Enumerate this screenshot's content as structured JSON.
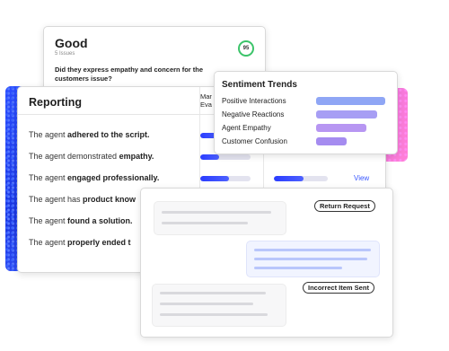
{
  "good_card": {
    "title": "Good",
    "subtitle": "5 Issues",
    "score": "95",
    "question": "Did they express empathy and concern for the customers issue?"
  },
  "reporting": {
    "title": "Reporting",
    "col_head_line1": "Mar",
    "col_head_line2": "Eva",
    "rows": [
      {
        "prefix": "The agent ",
        "bold": "adhered to the script.",
        "bar1": 0.38,
        "bar2": 0.0
      },
      {
        "prefix": "The agent demonstrated ",
        "bold": "empathy.",
        "bar1": 0.38,
        "bar2": 0.0
      },
      {
        "prefix": "The agent ",
        "bold": "engaged professionally.",
        "bar1": 0.58,
        "bar2": 0.55
      },
      {
        "prefix": "The agent has ",
        "bold": "product know",
        "bar1": 0,
        "bar2": 0
      },
      {
        "prefix": "The agent ",
        "bold": "found a solution.",
        "bar1": 0,
        "bar2": 0
      },
      {
        "prefix": "The agent ",
        "bold": "properly ended t",
        "bar1": 0,
        "bar2": 0
      }
    ],
    "view_link": "View"
  },
  "sentiment": {
    "title": "Sentiment Trends",
    "items": [
      {
        "label": "Positive Interactions",
        "value": 0.96,
        "color": "#8fa6f5"
      },
      {
        "label": "Negative Reactions",
        "value": 0.85,
        "color": "#a79ef4"
      },
      {
        "label": "Agent Empathy",
        "value": 0.7,
        "color": "#b796f2"
      },
      {
        "label": "Customer Confusion",
        "value": 0.43,
        "color": "#a58cf0"
      }
    ]
  },
  "chat": {
    "tag_return": "Return Request",
    "tag_incorrect": "Incorrect Item Sent"
  },
  "colors": {
    "accent": "#3a58ff",
    "score_ring": "#3cc46a"
  }
}
